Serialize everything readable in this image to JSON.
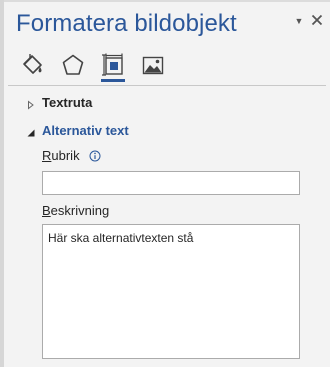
{
  "pane": {
    "title": "Formatera bildobjekt",
    "options_icon": "dropdown-arrow-icon",
    "close_icon": "close-icon"
  },
  "tabs": [
    {
      "name": "fill-line-tab",
      "icon": "paint-bucket-icon",
      "selected": false
    },
    {
      "name": "effects-tab",
      "icon": "pentagon-icon",
      "selected": false
    },
    {
      "name": "size-properties-tab",
      "icon": "size-layout-icon",
      "selected": true
    },
    {
      "name": "picture-tab",
      "icon": "picture-icon",
      "selected": false
    }
  ],
  "sections": {
    "textruta": {
      "label": "Textruta",
      "expanded": false
    },
    "alt_text": {
      "label": "Alternativ text",
      "expanded": true
    }
  },
  "fields": {
    "rubrik": {
      "label_mnemonic": "R",
      "label_rest": "ubrik",
      "value": ""
    },
    "beskrivning": {
      "label_mnemonic": "B",
      "label_rest": "eskrivning",
      "value": "Här ska alternativtexten stå"
    }
  },
  "colors": {
    "accent": "#2b579a",
    "pane_background": "#f3f3f3",
    "input_border": "#ababab"
  }
}
